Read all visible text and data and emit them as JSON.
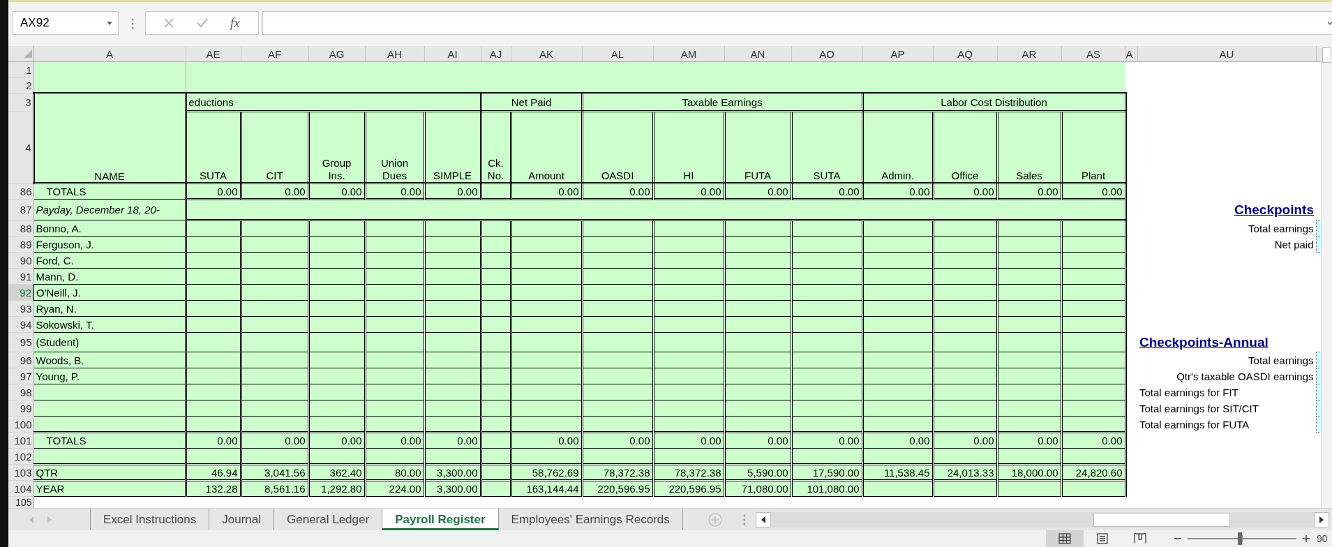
{
  "name_box": {
    "value": "AX92"
  },
  "formula_bar": {
    "function_label": "fx"
  },
  "columns": [
    "A",
    "AE",
    "AF",
    "AG",
    "AH",
    "AI",
    "AJ",
    "AK",
    "AL",
    "AM",
    "AN",
    "AO",
    "AP",
    "AQ",
    "AR",
    "AS",
    "A",
    "AU"
  ],
  "name_heading": "NAME",
  "column_groups": [
    {
      "title": "eductions",
      "continued": true,
      "columns": [
        "SUTA",
        "CIT",
        "Group\nIns.",
        "Union\nDues",
        "SIMPLE"
      ]
    },
    {
      "title": "Net Paid",
      "continued": false,
      "columns": [
        "Ck.\nNo.",
        "Amount"
      ]
    },
    {
      "title": "Taxable Earnings",
      "continued": false,
      "columns": [
        "OASDI",
        "HI",
        "FUTA",
        "SUTA"
      ]
    },
    {
      "title": "Labor Cost Distribution",
      "continued": false,
      "columns": [
        "Admin.",
        "Office",
        "Sales",
        "Plant"
      ]
    }
  ],
  "rows": [
    {
      "number": "1",
      "kind": "banner",
      "selected": false
    },
    {
      "number": "2",
      "kind": "banner",
      "selected": false
    },
    {
      "number": "3",
      "kind": "group-titles",
      "selected": false
    },
    {
      "number": "4",
      "kind": "column-titles",
      "selected": false
    },
    {
      "number": "86",
      "kind": "totals",
      "name": "TOTALS",
      "selected": false,
      "values": [
        {
          "value": "0.00"
        },
        {
          "value": "0.00"
        },
        {
          "value": "0.00"
        },
        {
          "value": "0.00"
        },
        {
          "value": "0.00"
        },
        {
          "kind": "empty"
        },
        {
          "value": "0.00"
        },
        {
          "value": "0.00"
        },
        {
          "value": "0.00"
        },
        {
          "value": "0.00"
        },
        {
          "value": "0.00"
        },
        {
          "value": "0.00"
        },
        {
          "value": "0.00"
        },
        {
          "value": "0.00"
        },
        {
          "value": "0.00"
        }
      ]
    },
    {
      "number": "87",
      "kind": "section",
      "name": "Payday, December 18, 20-",
      "selected": false,
      "side": {
        "kind": "heading",
        "text": "Checkpoints"
      }
    },
    {
      "number": "88",
      "kind": "entry",
      "name": "Bonno, A.",
      "selected": false,
      "side": {
        "kind": "label",
        "text": "Total earnings"
      }
    },
    {
      "number": "89",
      "kind": "entry",
      "name": "Ferguson, J.",
      "selected": false,
      "side": {
        "kind": "label",
        "text": "Net paid"
      }
    },
    {
      "number": "90",
      "kind": "entry",
      "name": "Ford, C.",
      "selected": false
    },
    {
      "number": "91",
      "kind": "entry",
      "name": "Mann, D.",
      "selected": false
    },
    {
      "number": "92",
      "kind": "entry",
      "name": "O'Neill, J.",
      "selected": true
    },
    {
      "number": "93",
      "kind": "entry",
      "name": "Ryan, N.",
      "selected": false
    },
    {
      "number": "94",
      "kind": "entry",
      "name": "Sokowski, T.",
      "selected": false
    },
    {
      "number": "95",
      "kind": "entry",
      "name": "(Student)",
      "selected": false,
      "side": {
        "kind": "caption",
        "text": "Checkpoints-Annual"
      }
    },
    {
      "number": "96",
      "kind": "entry",
      "name": "Woods, B.",
      "selected": false,
      "side": {
        "kind": "label",
        "text": "Total earnings"
      }
    },
    {
      "number": "97",
      "kind": "entry",
      "name": "Young, P.",
      "selected": false,
      "side": {
        "kind": "label",
        "text": "Qtr's taxable OASDI earnings"
      }
    },
    {
      "number": "98",
      "kind": "entry",
      "selected": false,
      "side": {
        "kind": "prompt",
        "text": "Total earnings for FIT"
      }
    },
    {
      "number": "99",
      "kind": "entry",
      "selected": false,
      "side": {
        "kind": "prompt",
        "text": "Total earnings for SIT/CIT"
      }
    },
    {
      "number": "100",
      "kind": "entry",
      "selected": false,
      "side": {
        "kind": "prompt",
        "text": "Total earnings for FUTA"
      }
    },
    {
      "number": "101",
      "kind": "totals",
      "name": "TOTALS",
      "selected": false,
      "values": [
        {
          "value": "0.00"
        },
        {
          "value": "0.00"
        },
        {
          "value": "0.00"
        },
        {
          "value": "0.00"
        },
        {
          "value": "0.00"
        },
        {
          "kind": "empty"
        },
        {
          "value": "0.00"
        },
        {
          "value": "0.00"
        },
        {
          "value": "0.00"
        },
        {
          "value": "0.00"
        },
        {
          "value": "0.00"
        },
        {
          "value": "0.00"
        },
        {
          "value": "0.00"
        },
        {
          "value": "0.00"
        },
        {
          "value": "0.00"
        }
      ]
    },
    {
      "number": "102",
      "kind": "entry",
      "selected": false
    },
    {
      "number": "103",
      "kind": "summary",
      "name": "QTR",
      "selected": false,
      "values": [
        {
          "value": "46.94"
        },
        {
          "value": "3,041.56"
        },
        {
          "value": "362.40"
        },
        {
          "value": "80.00"
        },
        {
          "value": "3,300.00"
        },
        {
          "kind": "empty"
        },
        {
          "value": "58,762.69"
        },
        {
          "value": "78,372.38"
        },
        {
          "value": "78,372.38"
        },
        {
          "value": "5,590.00"
        },
        {
          "value": "17,590.00"
        },
        {
          "value": "11,538.45"
        },
        {
          "value": "24,013.33"
        },
        {
          "value": "18,000.00"
        },
        {
          "value": "24,820.60"
        }
      ]
    },
    {
      "number": "104",
      "kind": "summary",
      "name": "YEAR",
      "selected": false,
      "values": [
        {
          "value": "132.28"
        },
        {
          "value": "8,561.16"
        },
        {
          "value": "1,292.80"
        },
        {
          "value": "224.00"
        },
        {
          "value": "3,300.00"
        },
        {
          "kind": "empty"
        },
        {
          "value": "163,144.44"
        },
        {
          "value": "220,596.95"
        },
        {
          "value": "220,596.95"
        },
        {
          "value": "71,080.00"
        },
        {
          "value": "101,080.00"
        },
        {
          "kind": "empty"
        },
        {
          "kind": "empty"
        },
        {
          "kind": "empty"
        },
        {
          "kind": "empty"
        }
      ]
    },
    {
      "number": "105",
      "kind": "blank",
      "selected": false
    }
  ],
  "sheet_tabs": [
    {
      "label": "Excel Instructions",
      "selected": false
    },
    {
      "label": "Journal",
      "selected": false
    },
    {
      "label": "General Ledger",
      "selected": false
    },
    {
      "label": "Payroll Register",
      "selected": true
    },
    {
      "label": "Employees' Earnings Records",
      "selected": false
    }
  ],
  "status_bar": {
    "views": [
      {
        "kind": "normal",
        "selected": true
      },
      {
        "kind": "page-layout",
        "selected": false
      },
      {
        "kind": "page-break",
        "selected": false
      }
    ],
    "zoom": {
      "level": 0.48,
      "label": "90"
    }
  }
}
